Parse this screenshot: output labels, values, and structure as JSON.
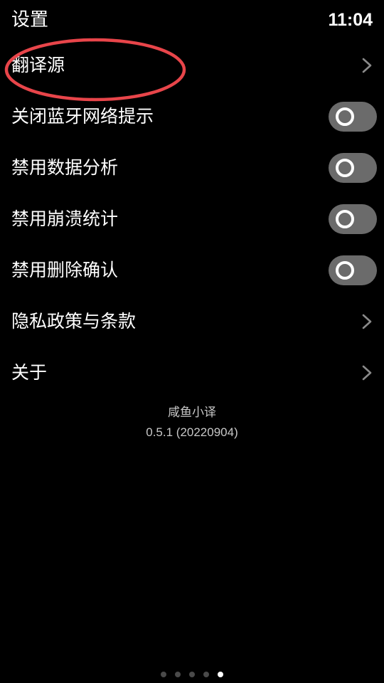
{
  "header": {
    "title": "设置",
    "time": "11:04"
  },
  "settings": {
    "items": [
      {
        "label": "翻译源",
        "type": "link"
      },
      {
        "label": "关闭蓝牙网络提示",
        "type": "toggle",
        "on": false
      },
      {
        "label": "禁用数据分析",
        "type": "toggle",
        "on": false
      },
      {
        "label": "禁用崩溃统计",
        "type": "toggle",
        "on": false
      },
      {
        "label": "禁用删除确认",
        "type": "toggle",
        "on": false
      },
      {
        "label": "隐私政策与条款",
        "type": "link"
      },
      {
        "label": "关于",
        "type": "link"
      }
    ]
  },
  "app_info": {
    "name": "咸鱼小译",
    "version": "0.5.1 (20220904)"
  },
  "pager": {
    "count": 5,
    "active_index": 4
  },
  "colors": {
    "background": "#000000",
    "text": "#ffffff",
    "secondary_text": "#c8c8c8",
    "toggle_off": "#6b6b6b",
    "chevron": "#8a8a8a",
    "annotation": "#e8454a"
  },
  "icons": {
    "row_chevron": "chevron-right-icon",
    "toggle_knob": "ring-knob"
  }
}
